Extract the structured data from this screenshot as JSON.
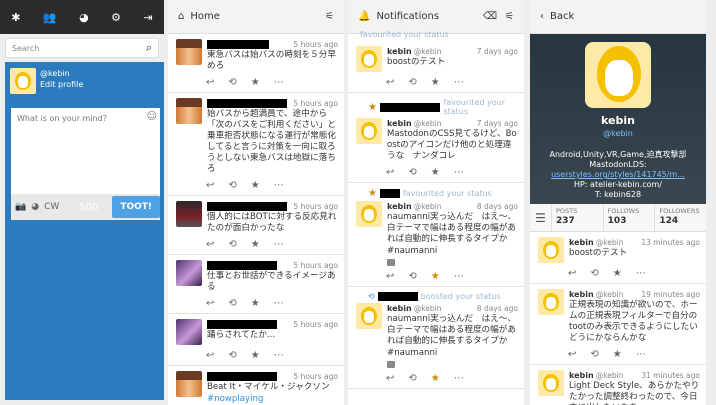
{
  "drawer": {
    "nav_icons": [
      "asterisk-icon",
      "people-icon",
      "globe-icon",
      "gear-icon",
      "logout-icon"
    ],
    "search_placeholder": "Search",
    "me_acct": "@kebin",
    "me_edit": "Edit profile",
    "compose_placeholder": "What is on your mind?",
    "cw_label": "CW",
    "char_count": "500",
    "toot_label": "TOOT!"
  },
  "home": {
    "title": "Home",
    "statuses": [
      {
        "time": "5 hours ago",
        "text": "東急バスは始バスの時刻を５分早めろ"
      },
      {
        "time": "5 hours ago",
        "text": "始バスから超満員で、途中から「次のバスをご利用ください」と乗車拒否状態になる運行が常態化してると言うに対策を一向に取ろうとしない東急バスは地獄に落ちろ"
      },
      {
        "time": "5 hours ago",
        "text": "個人的にはBOTに対する反応見れたのが面白かったな"
      },
      {
        "time": "5 hours ago",
        "text": "仕事とお世話ができるイメージある"
      },
      {
        "time": "5 hours ago",
        "text": "踊らされてたか..."
      },
      {
        "time": "5 hours ago",
        "text": "Beat It・マイケル・ジャクソン",
        "tag": "#nowplaying"
      }
    ]
  },
  "notifications": {
    "title": "Notifications",
    "top_fragment": "favourited your status",
    "items": [
      {
        "name": "kebin",
        "acct": "@kebin",
        "time": "7 days ago",
        "text": "boostのテスト"
      },
      {
        "notice": "favourited your status",
        "name": "kebin",
        "acct": "@kebin",
        "time": "7 days ago",
        "text": "MastodonのCSS見てるけど、Boostのアイコンだけ他のと処理違うな　ナンダコレ"
      },
      {
        "notice": "favourited your status",
        "name": "kebin",
        "acct": "@kebin",
        "time": "8 days ago",
        "text": "naumanni実っ込んだ　はえ～、白テーマで幅はある程度の幅があれば自動的に伸長するタイプか",
        "tag": "#naumanni"
      },
      {
        "notice": "boosted your status",
        "name": "kebin",
        "acct": "@kebin",
        "time": "8 days ago",
        "text": "naumanni実っ込んだ　はえ～、白テーマで幅はある程度の幅があれば自動的に伸長するタイプか",
        "tag": "#naumanni"
      }
    ]
  },
  "profile": {
    "back_label": "Back",
    "name": "kebin",
    "acct": "@kebin",
    "note1": "Android,Unity,VR,Game,迫真攻撃部",
    "note2": "MastodonLDS:",
    "note_link": "userstyles.org/styles/141745/m...",
    "hp": "HP: atelier-kebin.com/",
    "twitter": "T: kebin628",
    "stats": [
      {
        "label": "POSTS",
        "value": "237"
      },
      {
        "label": "FOLLOWS",
        "value": "103"
      },
      {
        "label": "FOLLOWERS",
        "value": "124"
      }
    ],
    "statuses": [
      {
        "name": "kebin",
        "acct": "@kebin",
        "time": "13 minutes ago",
        "text": "boostのテスト"
      },
      {
        "name": "kebin",
        "acct": "@kebin",
        "time": "19 minutes ago",
        "text": "正規表現の知識が欲いので、ホームの正規表現フィルターで自分のtootのみ表示できるようにしたい　どうにかならんかな"
      },
      {
        "name": "kebin",
        "acct": "@kebin",
        "time": "31 minutes ago",
        "text": "Light Deck Style、あらかたやりたかった調整終わったので、今日中に出したいなあ"
      }
    ]
  }
}
